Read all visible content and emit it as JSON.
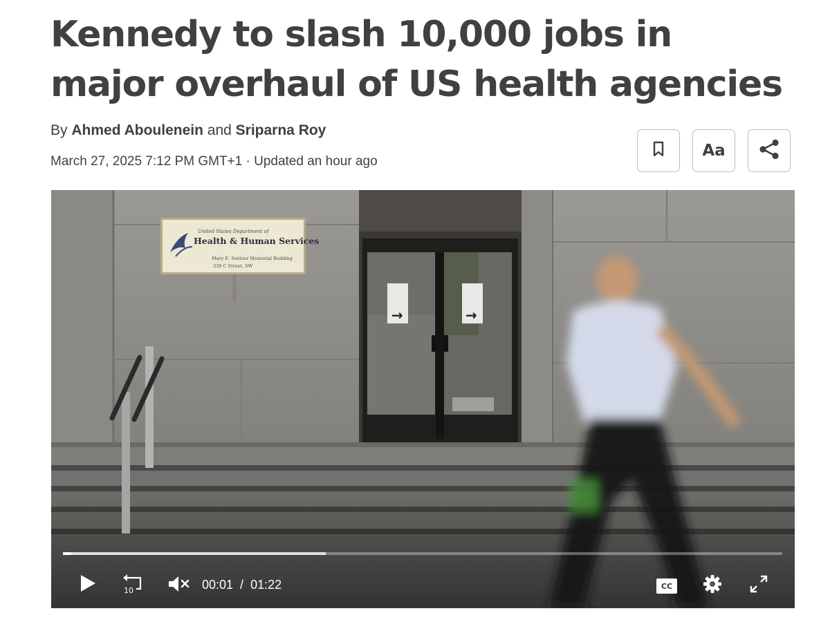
{
  "article": {
    "headline": "Kennedy to slash 10,000 jobs in major overhaul of US health agencies",
    "byline": {
      "prefix": "By",
      "author_1": "Ahmed Aboulenein",
      "conjunction": "and",
      "author_2": "Sriparna Roy"
    },
    "date": "March 27, 2025 7:12 PM GMT+1",
    "separator": "·",
    "updated": "Updated an hour ago"
  },
  "toolbar": {
    "bookmark_icon": "bookmark-icon",
    "text_size_label": "Aa",
    "share_icon": "share-icon"
  },
  "video": {
    "sign": {
      "line1": "United States Department of",
      "line2": "Health & Human Services",
      "line3": "Mary E. Switzer Memorial Building",
      "line4": "330 C Street, SW"
    },
    "player": {
      "current_time": "00:01",
      "time_separator": "/",
      "duration": "01:22",
      "played_fraction": 0.012,
      "buffered_fraction": 0.365,
      "rewind_label": "10",
      "cc_label": "CC",
      "play_icon": "play-icon",
      "rewind_icon": "rewind-10-icon",
      "mute_icon": "muted-speaker-icon",
      "settings_icon": "gear-icon",
      "fullscreen_icon": "fullscreen-icon"
    }
  },
  "colors": {
    "headline": "#404040",
    "text": "#404040",
    "button_border": "#bdbdbd",
    "player_ui": "#ffffff"
  }
}
